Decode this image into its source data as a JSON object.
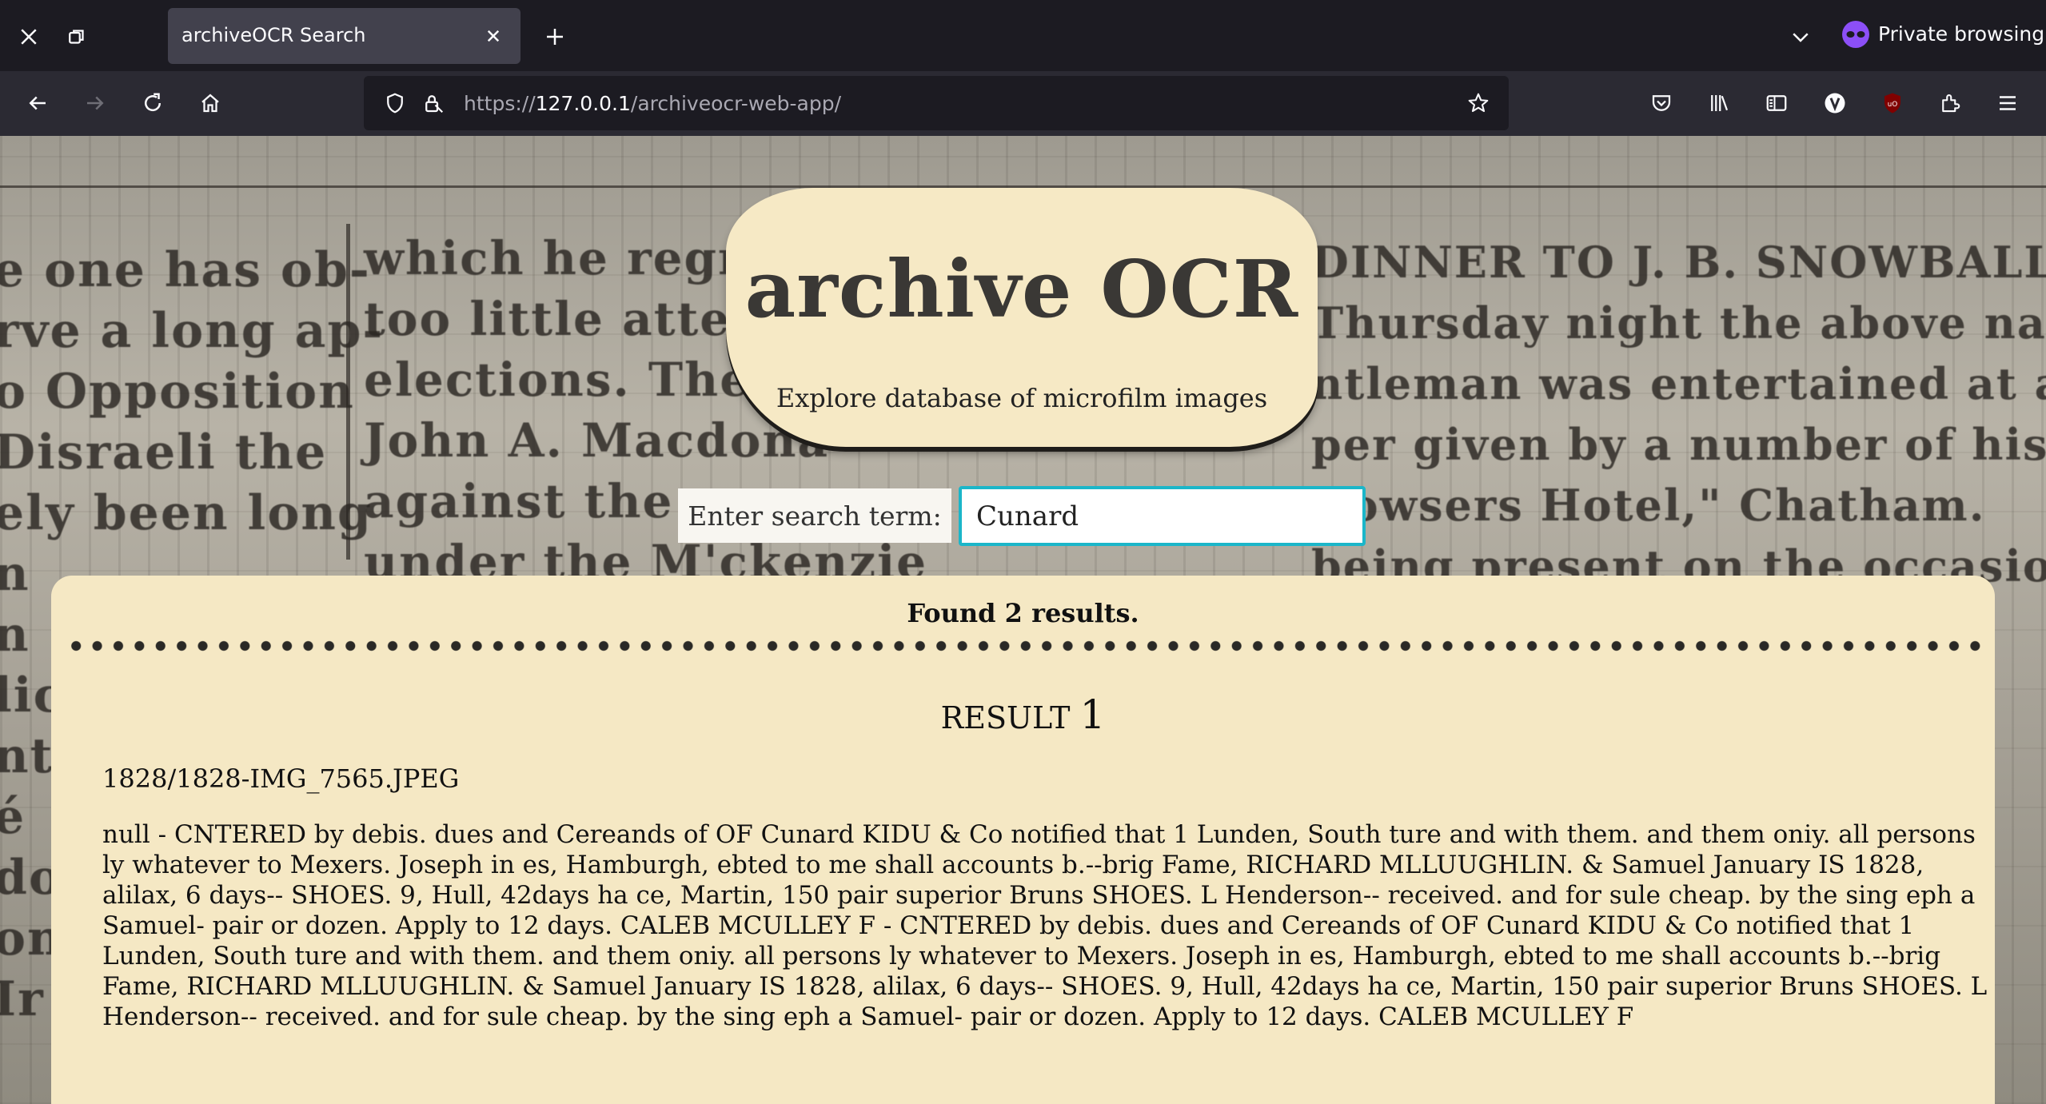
{
  "browser": {
    "tab_title": "archiveOCR Search",
    "private_label": "Private browsing",
    "url_prefix": "https://",
    "url_host": "127.0.0.1",
    "url_path": "/archiveocr-web-app/"
  },
  "background_newspaper": {
    "col1": [
      "e one has ob-",
      "rve a long ap-",
      "o  Opposition",
      "  Disraeli  the",
      "ely been long",
      "n",
      "n",
      "lic",
      "nt",
      "é",
      "do",
      "on",
      "Ir"
    ],
    "col2": [
      "which he regrett",
      "too little  atten",
      "elections.  The",
      "John A. Macdona",
      "against the ex",
      "under  the  M'ckenzie"
    ],
    "col3": [
      "DINNER TO J. B. SNOWBALL, Esq",
      "Thursday night the above nar",
      "ntleman was entertained at a S",
      "per given by a number of his frien",
      "Bowsers  Hotel,\" Chatham.",
      "being present on the occasion we c"
    ]
  },
  "header": {
    "title": "archive OCR",
    "subtitle": "Explore database of microfilm images"
  },
  "search": {
    "label": "Enter search term:",
    "value": "Cunard"
  },
  "results": {
    "summary": "Found 2 results.",
    "items": [
      {
        "heading_word": "RESULT",
        "heading_number": "1",
        "file": "1828/1828-IMG_7565.JPEG",
        "text": "null - CNTERED by debis. dues and Cereands of OF Cunard KIDU & Co notified that 1 Lunden, South ture and with them. and them oniy. all persons ly whatever to Mexers. Joseph in es, Hamburgh, ebted to me shall accounts b.--brig Fame, RICHARD MLLUUGHLIN. & Samuel January IS 1828, alilax, 6 days-- SHOES. 9, Hull, 42days ha ce, Martin, 150 pair superior Bruns SHOES. L Henderson-- received. and for sule cheap. by the sing eph a Samuel- pair or dozen. Apply to 12 days. CALEB MCULLEY F - CNTERED by debis. dues and Cereands of OF Cunard KIDU & Co notified that 1 Lunden, South ture and with them. and them oniy. all persons ly whatever to Mexers. Joseph in es, Hamburgh, ebted to me shall accounts b.--brig Fame, RICHARD MLLUUGHLIN. & Samuel January IS 1828, alilax, 6 days-- SHOES. 9, Hull, 42days ha ce, Martin, 150 pair superior Bruns SHOES. L Henderson-- received. and for sule cheap. by the sing eph a Samuel- pair or dozen. Apply to 12 days. CALEB MCULLEY F"
      }
    ]
  },
  "colors": {
    "panel_bg": "#f5e8c4",
    "header_bg": "#f6e9c5",
    "input_focus": "#1bb6c9",
    "chrome_dark": "#1c1b22",
    "chrome_nav": "#2b2a33",
    "private_accent": "#8c4ff7",
    "ublock_red": "#800000"
  }
}
